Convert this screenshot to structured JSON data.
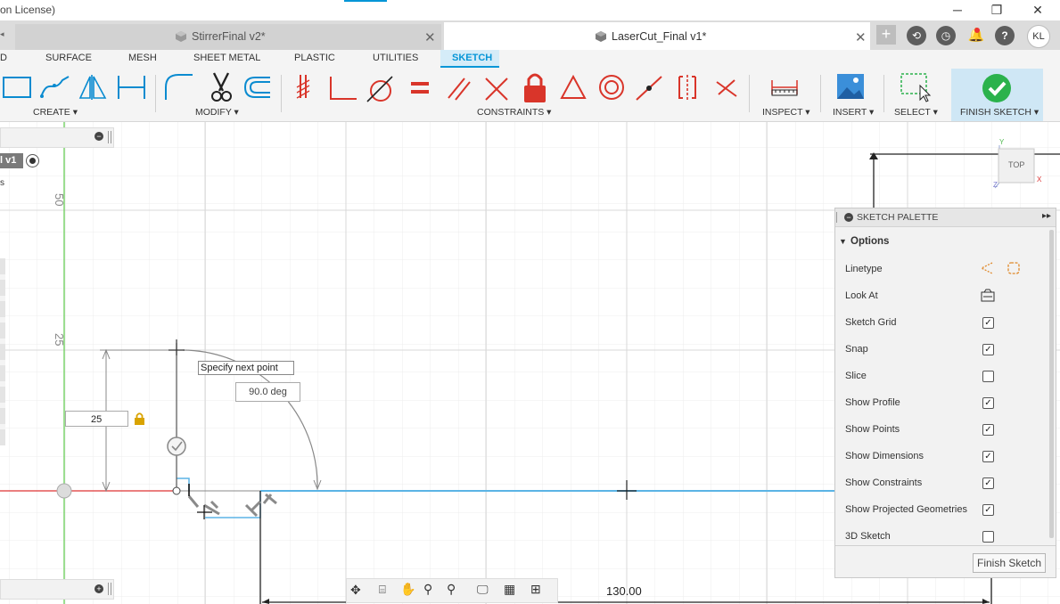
{
  "window": {
    "title": "on License)",
    "minimize": "─",
    "restore": "❐",
    "close": "✕"
  },
  "tabs": [
    {
      "label": "StirrerFinal v2*",
      "close": "✕"
    },
    {
      "label": "LaserCut_Final v1*",
      "close": "✕"
    }
  ],
  "header": {
    "add_tab": "+",
    "user_initials": "KL",
    "help": "?"
  },
  "workspace_tabs": [
    "D",
    "SURFACE",
    "MESH",
    "SHEET METAL",
    "PLASTIC",
    "UTILITIES",
    "SKETCH"
  ],
  "active_workspace_tab": "SKETCH",
  "toolbar_groups": {
    "create": "CREATE ▾",
    "modify": "MODIFY ▾",
    "constraints": "CONSTRAINTS ▾",
    "inspect": "INSPECT ▾",
    "insert": "INSERT ▾",
    "select": "SELECT ▾",
    "finish": "FINISH SKETCH ▾"
  },
  "browser": {
    "item_label": "l v1",
    "item_label2": "s"
  },
  "canvas": {
    "ruler_50": "50",
    "ruler_25": "25",
    "tooltip": "Specify next point",
    "angle_value": "90.0 deg",
    "length_value": "25",
    "dimension_bottom": "130.00",
    "viewcube_label": "TOP",
    "axis_y": "Y",
    "axis_x": "X",
    "axis_z": "Z"
  },
  "sketch_palette": {
    "title": "SKETCH PALETTE",
    "section": "Options",
    "options": [
      {
        "label": "Linetype",
        "control": "icons"
      },
      {
        "label": "Look At",
        "control": "icon"
      },
      {
        "label": "Sketch Grid",
        "control": "checkbox",
        "checked": true
      },
      {
        "label": "Snap",
        "control": "checkbox",
        "checked": true
      },
      {
        "label": "Slice",
        "control": "checkbox",
        "checked": false
      },
      {
        "label": "Show Profile",
        "control": "checkbox",
        "checked": true
      },
      {
        "label": "Show Points",
        "control": "checkbox",
        "checked": true
      },
      {
        "label": "Show Dimensions",
        "control": "checkbox",
        "checked": true
      },
      {
        "label": "Show Constraints",
        "control": "checkbox",
        "checked": true
      },
      {
        "label": "Show Projected Geometries",
        "control": "checkbox",
        "checked": true
      },
      {
        "label": "3D Sketch",
        "control": "checkbox",
        "checked": false
      }
    ],
    "finish_button": "Finish Sketch"
  },
  "colors": {
    "accent": "#0696d7",
    "finish_green": "#2bb24c",
    "constraint_red": "#d9352a",
    "x_axis": "#d33",
    "y_axis": "#3c3",
    "sketch_line": "#5bb4e5"
  }
}
